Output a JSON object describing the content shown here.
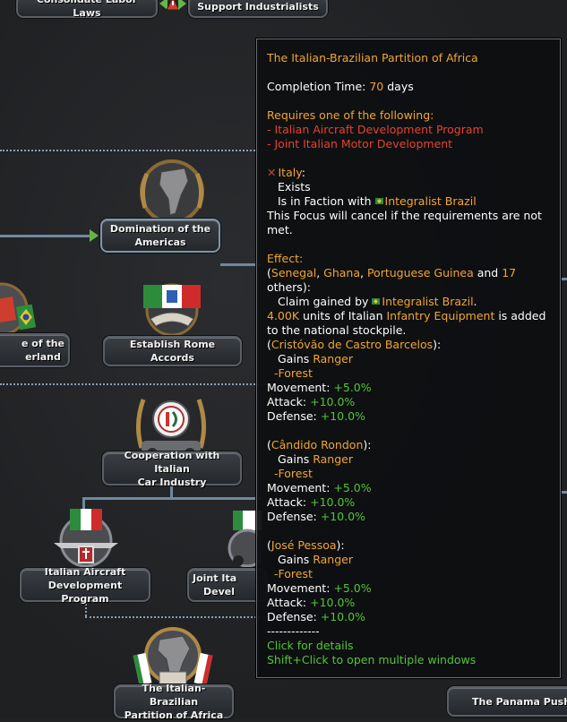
{
  "top_buttons": {
    "left": "Consolidate Labor Laws",
    "right": "Support Industrialists"
  },
  "focuses": {
    "domination": [
      "Domination of the",
      "Americas"
    ],
    "partial_left": [
      "e of the",
      "erland"
    ],
    "rome_accords": "Establish Rome Accords",
    "cooperation": [
      "Cooperation with Italian",
      "Car Industry"
    ],
    "aircraft": [
      "Italian Aircraft",
      "Development Program"
    ],
    "joint_partial": [
      "Joint Ita",
      "Devel"
    ],
    "partition": [
      "The Italian-Brazilian",
      "Partition of Africa"
    ],
    "panama": "The Panama Push"
  },
  "tooltip": {
    "title": "The Italian-Brazilian Partition of Africa",
    "completion_label": "Completion Time: ",
    "completion_value": "70",
    "completion_unit": " days",
    "requires_header": "Requires one of the following:",
    "requires": [
      "- Italian Aircraft Development Program",
      "- Joint Italian Motor Development"
    ],
    "country": "Italy",
    "country_suffix": ":",
    "exists": "Exists",
    "faction_prefix": "Is in Faction with ",
    "faction_target": "Integralist Brazil",
    "cancel_note": "This Focus will cancel if the requirements are not met.",
    "effect_header": "Effect:",
    "states_open": "(",
    "states": [
      "Senegal",
      "Ghana",
      "Portuguese Guinea"
    ],
    "states_sep": ", ",
    "states_and": " and ",
    "others_count": "17",
    "others_suffix": "others):",
    "claim_prefix": "Claim gained by ",
    "claim_target": "Integralist Brazil",
    "claim_end": ".",
    "equip_amount": "4.00K",
    "equip_mid": " units of Italian ",
    "equip_name": "Infantry Equipment",
    "equip_end": " is added to the national stockpile.",
    "generals": [
      {
        "name": "Cristóvão de Castro Barcelos",
        "gains": "Gains ",
        "trait": "Ranger",
        "terrain": "-Forest",
        "stats": [
          {
            "label": "Movement: ",
            "value": "+5.0%"
          },
          {
            "label": "Attack: ",
            "value": "+10.0%"
          },
          {
            "label": "Defense: ",
            "value": "+10.0%"
          }
        ]
      },
      {
        "name": "Cândido Rondon",
        "gains": "Gains ",
        "trait": "Ranger",
        "terrain": "-Forest",
        "stats": [
          {
            "label": "Movement: ",
            "value": "+5.0%"
          },
          {
            "label": "Attack: ",
            "value": "+10.0%"
          },
          {
            "label": "Defense: ",
            "value": "+10.0%"
          }
        ]
      },
      {
        "name": "José Pessoa",
        "gains": "Gains ",
        "trait": "Ranger",
        "terrain": "-Forest",
        "stats": [
          {
            "label": "Movement: ",
            "value": "+5.0%"
          },
          {
            "label": "Attack: ",
            "value": "+10.0%"
          },
          {
            "label": "Defense: ",
            "value": "+10.0%"
          }
        ]
      }
    ],
    "separator": "-------------",
    "hint1": "Click for details",
    "hint2": "Shift+Click to open multiple windows"
  }
}
